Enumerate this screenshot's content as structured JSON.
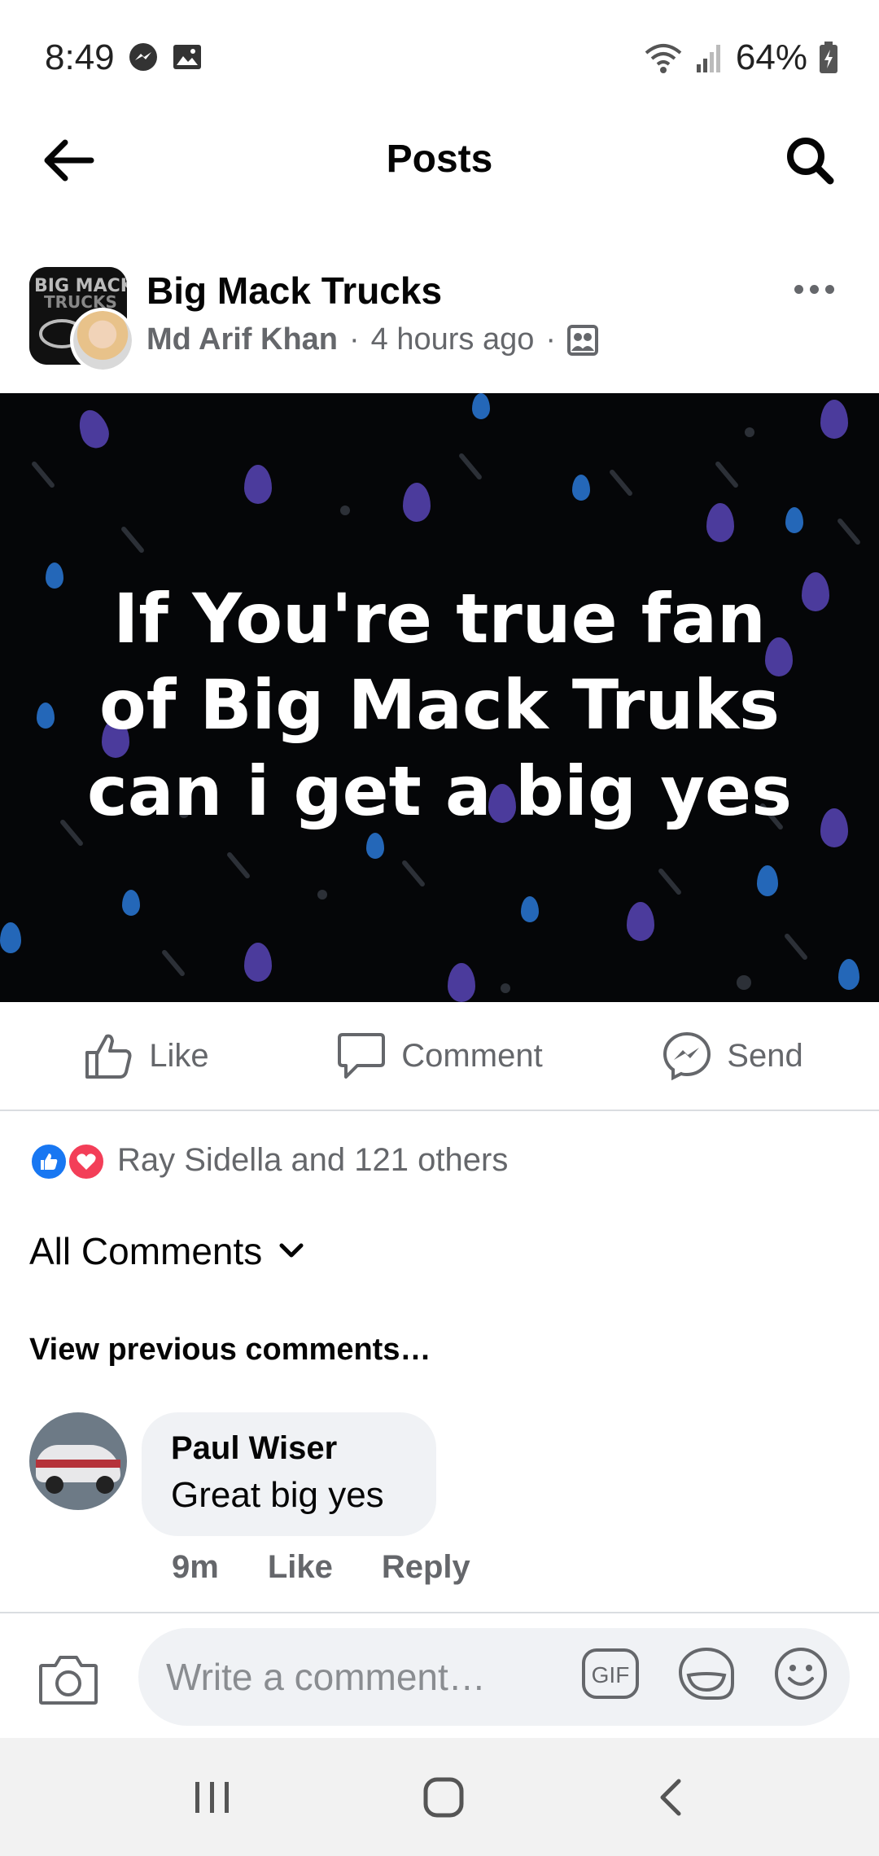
{
  "status_bar": {
    "time": "8:49",
    "battery": "64%"
  },
  "header": {
    "title": "Posts"
  },
  "post": {
    "page_name": "Big Mack Trucks",
    "author": "Md Arif Khan",
    "time_ago": "4 hours ago",
    "separator": "·",
    "avatar_logo_text": "BIG MACK TRUCKS",
    "text": "If You're true fan of Big Mack Truks can i get a big yes"
  },
  "actions": {
    "like": "Like",
    "comment": "Comment",
    "send": "Send"
  },
  "reactions": {
    "summary": "Ray Sidella and 121 others"
  },
  "comments": {
    "filter_label": "All Comments",
    "view_previous": "View previous comments…",
    "items": [
      {
        "author": "Paul Wiser",
        "text": "Great big yes",
        "time": "9m",
        "like_label": "Like",
        "reply_label": "Reply"
      }
    ]
  },
  "composer": {
    "placeholder": "Write a comment…",
    "gif_label": "GIF"
  },
  "colors": {
    "facebook_blue": "#1877f2",
    "love_red": "#f33e58",
    "secondary_text": "#65676b",
    "bubble_bg": "#f0f2f5",
    "post_bg": "#050608"
  }
}
